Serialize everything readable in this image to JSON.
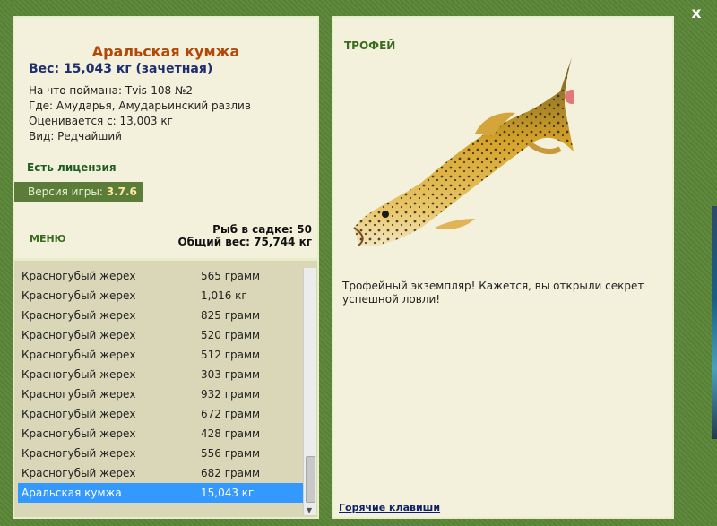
{
  "fish": {
    "name": "Аральская кумжа",
    "weight": "Вес: 15,043 кг (зачетная)",
    "caught_with": "На что поймана: Tvis-108 №2",
    "where": "Где: Амударья, Амударьинский разлив",
    "value_from": "Оценивается с: 13,003 кг",
    "kind": "Вид: Редчайший"
  },
  "license": "Есть лицензия",
  "version": {
    "label": "Версия игры: ",
    "value": "3.7.6"
  },
  "menu_label": "МЕНЮ",
  "keepnet": {
    "count": "Рыб в садке: 50",
    "total": "Общий вес: 75,744 кг"
  },
  "catch_list": [
    {
      "name": "Красногубый жерех",
      "weight": "565 грамм"
    },
    {
      "name": "Красногубый жерех",
      "weight": "1,016 кг"
    },
    {
      "name": "Красногубый жерех",
      "weight": "825 грамм"
    },
    {
      "name": "Красногубый жерех",
      "weight": "520 грамм"
    },
    {
      "name": "Красногубый жерех",
      "weight": "512 грамм"
    },
    {
      "name": "Красногубый жерех",
      "weight": "303 грамм"
    },
    {
      "name": "Красногубый жерех",
      "weight": "932 грамм"
    },
    {
      "name": "Красногубый жерех",
      "weight": "672 грамм"
    },
    {
      "name": "Красногубый жерех",
      "weight": "428 грамм"
    },
    {
      "name": "Красногубый жерех",
      "weight": "556 грамм"
    },
    {
      "name": "Красногубый жерех",
      "weight": "682 грамм"
    },
    {
      "name": "Аральская кумжа",
      "weight": "15,043 кг",
      "selected": true
    }
  ],
  "trophy": {
    "title": "ТРОФЕЙ",
    "text": "Трофейный экземпляр! Кажется, вы открыли секрет успешной ловли!"
  },
  "hotkeys": "Горячие клавиши",
  "close_label": "x",
  "colors": {
    "frame": "#5f8a3c",
    "panel": "#f3f1dc",
    "list": "#d9d7b7",
    "selected": "#3399ff",
    "name": "#b34708",
    "weight": "#1f2c6e"
  }
}
